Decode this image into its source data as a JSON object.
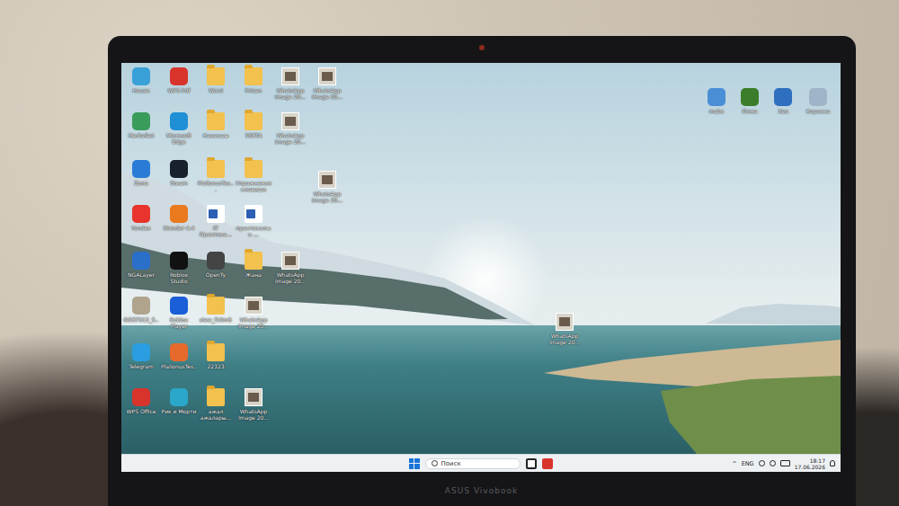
{
  "desktop": {
    "icons": [
      {
        "label": "Hasan",
        "kind": "app"
      },
      {
        "label": "WPS Pdf",
        "kind": "app"
      },
      {
        "label": "Word",
        "kind": "folder"
      },
      {
        "label": "Prizen",
        "kind": "folder"
      },
      {
        "label": "WhatsApp Image 20...",
        "kind": "image"
      },
      {
        "label": "WhatsApp Image 20...",
        "kind": "image"
      },
      {
        "label": "MediaGet",
        "kind": "app"
      },
      {
        "label": "Microsoft Edge",
        "kind": "app"
      },
      {
        "label": "Казакшы",
        "kind": "folder"
      },
      {
        "label": "SSETA",
        "kind": "folder"
      },
      {
        "label": "WhatsApp Image 20...",
        "kind": "image"
      },
      {
        "label": "Zona",
        "kind": "app"
      },
      {
        "label": "Steam",
        "kind": "app"
      },
      {
        "label": "PlalionusTes...",
        "kind": "folder"
      },
      {
        "label": "Упражнения клавиши",
        "kind": "folder"
      },
      {
        "label": "WhatsApp Image 20...",
        "kind": "image"
      },
      {
        "label": "Yandex",
        "kind": "app"
      },
      {
        "label": "Blender 4.4",
        "kind": "app"
      },
      {
        "label": "IT Практика...",
        "kind": "doc"
      },
      {
        "label": "практикалык ...",
        "kind": "doc"
      },
      {
        "label": "NGALayer",
        "kind": "app"
      },
      {
        "label": "Roblox Studio",
        "kind": "app"
      },
      {
        "label": "OpenTy",
        "kind": "app"
      },
      {
        "label": "Жаңа",
        "kind": "folder"
      },
      {
        "label": "WhatsApp Image 20...",
        "kind": "image"
      },
      {
        "label": "GOST512_S...",
        "kind": "app"
      },
      {
        "label": "Roblox Player",
        "kind": "app"
      },
      {
        "label": "slew_f10m5",
        "kind": "folder"
      },
      {
        "label": "WhatsApp Image 20...",
        "kind": "image"
      },
      {
        "label": "Telegram",
        "kind": "app"
      },
      {
        "label": "PlalionusTes...",
        "kind": "app"
      },
      {
        "label": "22323",
        "kind": "folder"
      },
      {
        "label": "WPS Office",
        "kind": "app"
      },
      {
        "label": "Рик и Морти",
        "kind": "app"
      },
      {
        "label": "ажал ажалары...",
        "kind": "folder"
      },
      {
        "label": "WhatsApp Image 20...",
        "kind": "image"
      },
      {
        "label": "WhatsApp Image 20...",
        "kind": "image"
      },
      {
        "label": "mabs",
        "kind": "app"
      },
      {
        "label": "Олма",
        "kind": "app"
      },
      {
        "label": "Xeo",
        "kind": "app"
      },
      {
        "label": "Корзина",
        "kind": "app"
      }
    ]
  },
  "taskbar": {
    "search": "Поиск",
    "tray": {
      "chevron": "^",
      "language": "ENG",
      "time": "18:17",
      "date": "17.06.2026"
    }
  },
  "bezel": {
    "brand": "ASUS Vivobook"
  }
}
